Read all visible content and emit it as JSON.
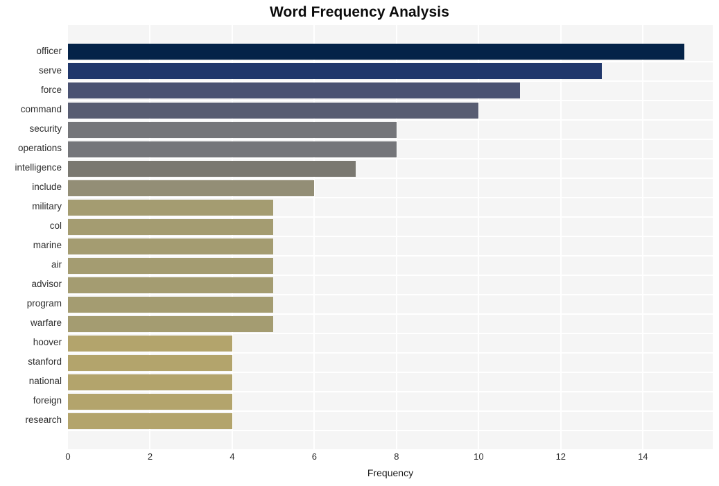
{
  "chart_data": {
    "type": "bar",
    "orientation": "horizontal",
    "title": "Word Frequency Analysis",
    "xlabel": "Frequency",
    "ylabel": "",
    "categories": [
      "officer",
      "serve",
      "force",
      "command",
      "security",
      "operations",
      "intelligence",
      "include",
      "military",
      "col",
      "marine",
      "air",
      "advisor",
      "program",
      "warfare",
      "hoover",
      "stanford",
      "national",
      "foreign",
      "research"
    ],
    "values": [
      15,
      13,
      11,
      10,
      8,
      8,
      7,
      6,
      5,
      5,
      5,
      5,
      5,
      5,
      5,
      4,
      4,
      4,
      4,
      4
    ],
    "bar_colors": [
      "#042348",
      "#20376b",
      "#4a5272",
      "#585d72",
      "#75767a",
      "#75767a",
      "#7a7871",
      "#938e76",
      "#a49c71",
      "#a49c71",
      "#a49c71",
      "#a49c71",
      "#a49c71",
      "#a49c71",
      "#a49c71",
      "#b3a46c",
      "#b3a46c",
      "#b3a46c",
      "#b3a46c",
      "#b3a46c"
    ],
    "xticks": [
      0,
      2,
      4,
      6,
      8,
      10,
      12,
      14
    ],
    "xlim": [
      0,
      15.7
    ],
    "grid": true,
    "legend": false,
    "plot_background": "#f5f5f5",
    "gridline_color": "#ffffff",
    "figure_background": "#ffffff"
  }
}
